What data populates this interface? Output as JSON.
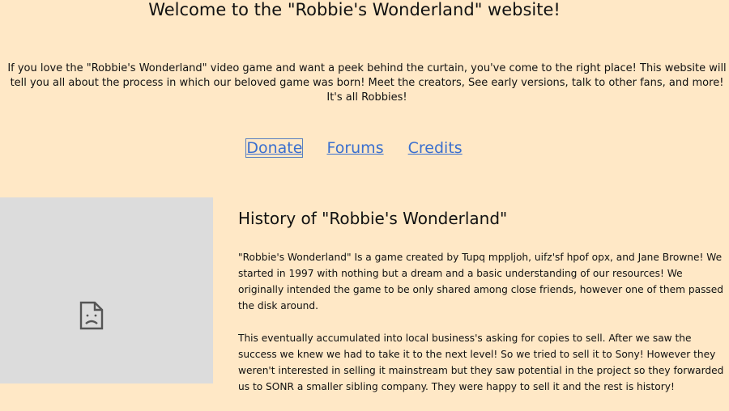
{
  "header": {
    "title": "Welcome to the \"Robbie's Wonderland\" website!"
  },
  "intro": {
    "text": "If you love the \"Robbie's Wonderland\" video game and want a peek behind the curtain, you've come to the right place! This website will tell you all about the process in which our beloved game was born! Meet the creators, See early versions, talk to other fans, and more! It's all Robbies!"
  },
  "nav": {
    "donate": "Donate",
    "forums": "Forums",
    "credits": "Credits"
  },
  "image": {
    "icon": "broken-image-icon"
  },
  "history": {
    "title": "History of \"Robbie's Wonderland\"",
    "paragraphs": [
      "\"Robbie's Wonderland\" Is a game created by Tupq mppljoh, uifz'sf hpof opx, and Jane Browne! We started in 1997 with nothing but a dream and a basic understanding of our resources! We originally intended the game to be only shared among close friends, however one of them passed the disk around.",
      "This eventually accumulated into local business's asking for copies to sell. After we saw the success we knew we had to take it to the next level! So we tried to sell it to Sony! However they weren't interested in selling it mainstream but they saw potential in the project so they forwarded us to SONR a smaller sibling company. They were happy to sell it and the rest is history!"
    ]
  },
  "colors": {
    "background": "#ffe8c6",
    "link": "#3a6fcf",
    "placeholder": "#dcdcdc"
  }
}
